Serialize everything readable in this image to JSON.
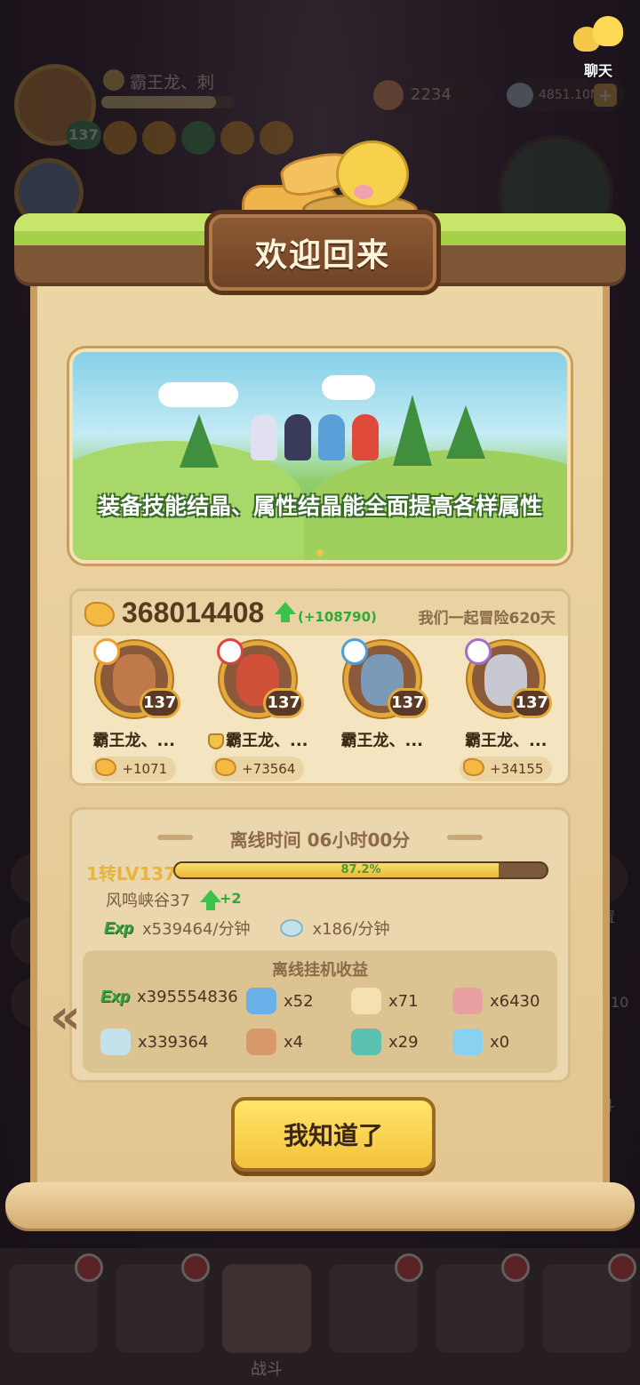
{
  "hud": {
    "player_name": "霸王龙、刺",
    "player_level": "137",
    "gold": "2234",
    "gems": "4851.10M",
    "plus": "+",
    "chat_label": "聊天",
    "side_label_right1": "置",
    "side_label_right2": "X10",
    "side_label_right3": "斗"
  },
  "dialog": {
    "title": "欢迎回来",
    "banner_text": "装备技能结晶、属性结晶能全面提高各样属性"
  },
  "team": {
    "total_gold": "368014408",
    "gold_gain": "(+108790)",
    "days_text": "我们一起冒险620天",
    "heroes": [
      {
        "name": "霸王龙、...",
        "level": "137",
        "gold": "+1071",
        "element_color": "#f0a030",
        "face_color": "#c07a4a"
      },
      {
        "name": "霸王龙、...",
        "level": "137",
        "gold": "+73564",
        "element_color": "#e04040",
        "face_color": "#d0503a"
      },
      {
        "name": "霸王龙、...",
        "level": "137",
        "gold": "",
        "element_color": "#4aa0e0",
        "face_color": "#7a9ab8"
      },
      {
        "name": "霸王龙、...",
        "level": "137",
        "gold": "+34155",
        "element_color": "#a070d0",
        "face_color": "#c8c8d0"
      }
    ]
  },
  "offline": {
    "time_text": "离线时间 06小时00分",
    "level_label": "1转LV137",
    "progress": 0.872,
    "progress_text": "87.2%",
    "stage": "风鸣峡谷37",
    "stage_gain": "+2",
    "exp_tag": "Exp",
    "exp_rate": "x539464/分钟",
    "gem_rate": "x186/分钟",
    "rewards_title": "离线挂机收益",
    "rewards": [
      {
        "icon": "exp-icon",
        "value": "x395554836"
      },
      {
        "icon": "blue-scroll-icon",
        "value": "x52"
      },
      {
        "icon": "candle-icon",
        "value": "x71"
      },
      {
        "icon": "medal-icon",
        "value": "x6430"
      },
      {
        "icon": "gem-icon",
        "value": "x339364"
      },
      {
        "icon": "meat-icon",
        "value": "x4"
      },
      {
        "icon": "teal-crystal-icon",
        "value": "x29"
      },
      {
        "icon": "ice-crystal-icon",
        "value": "x0"
      }
    ]
  },
  "buttons": {
    "ok_label": "我知道了",
    "prev_label": "«"
  },
  "bottom_nav": {
    "battle_label": "战斗"
  }
}
